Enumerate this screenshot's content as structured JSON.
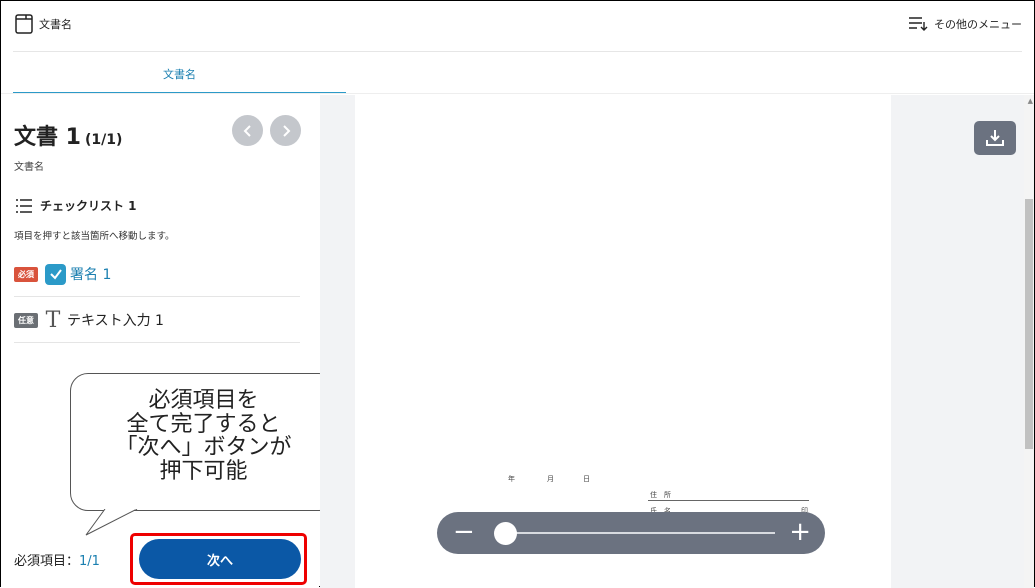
{
  "header": {
    "doc_title": "文書名",
    "menu_label": "その他のメニュー"
  },
  "tabs": [
    {
      "label": "文書名",
      "active": true
    }
  ],
  "sidebar": {
    "doc_heading": "文書 1",
    "doc_count": "(1/1)",
    "doc_subtitle": "文書名",
    "checklist_title": "チェックリスト 1",
    "checklist_desc": "項目を押すと該当箇所へ移動します。",
    "items": [
      {
        "badge": "必須",
        "label": "署名 1",
        "checked": true
      },
      {
        "badge": "任意",
        "label": "テキスト入力 1",
        "checked": false
      }
    ],
    "required_label": "必須項目：",
    "required_value": "1/1",
    "next_button": "次へ"
  },
  "callout": {
    "text": "必須項目を\n全て完了すると\n「次へ」ボタンが\n押下可能"
  },
  "document": {
    "year": "年",
    "month": "月",
    "day": "日",
    "address_label": "住　所",
    "name_label": "氏　名",
    "seal": "印"
  },
  "zoom": {
    "minus": "−",
    "plus": "+",
    "level": 0.03
  },
  "colors": {
    "accent": "#2b9ac8",
    "primary_button": "#0b58a6",
    "required_badge": "#d9533c",
    "optional_badge": "#6b6f74",
    "highlight": "#e00000"
  }
}
